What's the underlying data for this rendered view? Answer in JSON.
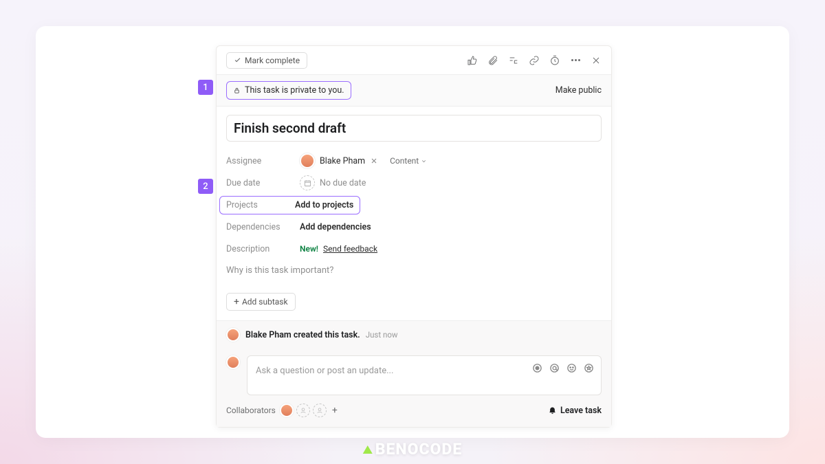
{
  "topbar": {
    "complete_label": "Mark complete"
  },
  "privacy": {
    "text": "This task is private to you.",
    "make_public": "Make public"
  },
  "task": {
    "title": "Finish second draft"
  },
  "fields": {
    "assignee_label": "Assignee",
    "assignee_name": "Blake Pham",
    "assignee_team": "Content",
    "due_label": "Due date",
    "due_value": "No due date",
    "projects_label": "Projects",
    "projects_action": "Add to projects",
    "deps_label": "Dependencies",
    "deps_action": "Add dependencies",
    "desc_label": "Description",
    "desc_new": "New!",
    "desc_feedback": "Send feedback",
    "desc_placeholder": "Why is this task important?"
  },
  "subtask": {
    "add": "Add subtask"
  },
  "history": {
    "text": "Blake Pham created this task.",
    "time": "Just now"
  },
  "comment": {
    "placeholder": "Ask a question or post an update..."
  },
  "footer": {
    "collab_label": "Collaborators",
    "leave": "Leave task"
  },
  "markers": {
    "one": "1",
    "two": "2"
  },
  "brand": "BENOCODE"
}
